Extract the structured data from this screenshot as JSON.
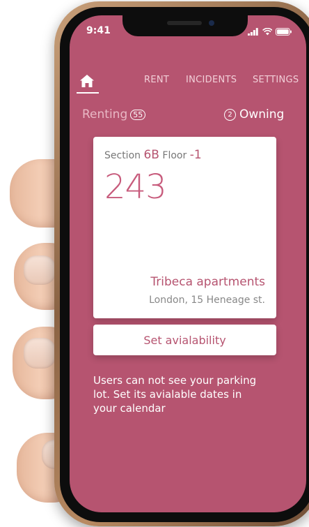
{
  "status_bar": {
    "time": "9:41"
  },
  "tabs": [
    {
      "label": "RENT"
    },
    {
      "label": "INCIDENTS"
    },
    {
      "label": "SETTINGS"
    }
  ],
  "toggle": {
    "renting_label": "Renting",
    "renting_count": "55",
    "owning_count": "2",
    "owning_label": "Owning"
  },
  "card": {
    "section_label": "Section",
    "section_value": "6B",
    "floor_label": "Floor",
    "floor_value": "-1",
    "spot_number": "243",
    "building": "Tribeca apartments",
    "address": "London, 15 Heneage st."
  },
  "availability_button": "Set avialability",
  "info_text": "Users can not see your parking lot. Set its avialable dates in your calendar",
  "colors": {
    "screen_bg": "#b65470",
    "accent": "#c75b7c",
    "card_bg": "#ffffff"
  },
  "icons": {
    "home": "home-icon",
    "signal": "signal-icon",
    "wifi": "wifi-icon",
    "battery": "battery-icon"
  }
}
